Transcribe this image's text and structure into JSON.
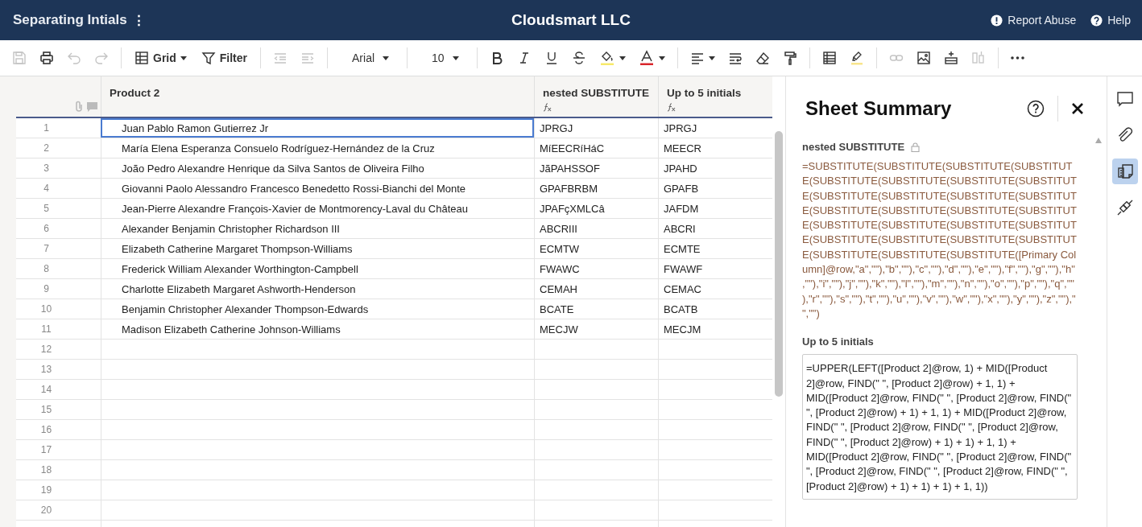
{
  "header": {
    "sheet_title": "Separating Intials",
    "menu_glyph": "⋮",
    "company": "Cloudsmart LLC",
    "links": [
      {
        "kind": "report",
        "label": "Report Abuse"
      },
      {
        "kind": "help",
        "label": "Help"
      }
    ]
  },
  "toolbar": {
    "save": {
      "disabled": true
    },
    "print": {
      "disabled": false
    },
    "undo": {
      "disabled": true
    },
    "redo": {
      "disabled": true
    },
    "view": {
      "label": "Grid"
    },
    "filter": {
      "label": "Filter"
    },
    "outdent": {
      "disabled": true
    },
    "indent": {
      "disabled": true
    },
    "font": {
      "label": "Arial"
    },
    "size": {
      "label": "10"
    },
    "link": {
      "disabled": true
    },
    "column_props": {
      "disabled": true
    }
  },
  "table": {
    "columns": [
      {
        "name": "Product 2",
        "formula": false
      },
      {
        "name": "nested SUBSTITUTE",
        "formula": true
      },
      {
        "name": "Up to 5 initials",
        "formula": true
      }
    ],
    "rows": [
      {
        "number": "1",
        "selected": true,
        "cells": [
          "Juan Pablo Ramon Gutierrez Jr",
          "JPRGJ",
          "JPRGJ"
        ]
      },
      {
        "number": "2",
        "selected": false,
        "cells": [
          "María Elena Esperanza Consuelo Rodríguez-Hernández de la Cruz",
          "MíEECRíHáC",
          "MEECR"
        ]
      },
      {
        "number": "3",
        "selected": false,
        "cells": [
          "João Pedro Alexandre Henrique da Silva Santos de Oliveira Filho",
          "JãPAHSSOF",
          "JPAHD"
        ]
      },
      {
        "number": "4",
        "selected": false,
        "cells": [
          "Giovanni Paolo Alessandro Francesco Benedetto Rossi-Bianchi del Monte",
          "GPAFBRBM",
          "GPAFB"
        ]
      },
      {
        "number": "5",
        "selected": false,
        "cells": [
          "Jean-Pierre Alexandre François-Xavier de Montmorency-Laval du Château",
          "JPAFçXMLCâ",
          "JAFDM"
        ]
      },
      {
        "number": "6",
        "selected": false,
        "cells": [
          "Alexander Benjamin Christopher Richardson III",
          "ABCRIII",
          "ABCRI"
        ]
      },
      {
        "number": "7",
        "selected": false,
        "cells": [
          "Elizabeth Catherine Margaret Thompson-Williams",
          "ECMTW",
          "ECMTE"
        ]
      },
      {
        "number": "8",
        "selected": false,
        "cells": [
          "Frederick William Alexander Worthington-Campbell",
          "FWAWC",
          "FWAWF"
        ]
      },
      {
        "number": "9",
        "selected": false,
        "cells": [
          "Charlotte Elizabeth Margaret Ashworth-Henderson",
          "CEMAH",
          "CEMAC"
        ]
      },
      {
        "number": "10",
        "selected": false,
        "cells": [
          "Benjamin Christopher Alexander Thompson-Edwards",
          "BCATE",
          "BCATB"
        ]
      },
      {
        "number": "11",
        "selected": false,
        "cells": [
          "Madison Elizabeth Catherine Johnson-Williams",
          "MECJW",
          "MECJM"
        ]
      },
      {
        "number": "12",
        "selected": false,
        "cells": []
      },
      {
        "number": "13",
        "selected": false,
        "cells": []
      },
      {
        "number": "14",
        "selected": false,
        "cells": []
      },
      {
        "number": "15",
        "selected": false,
        "cells": []
      },
      {
        "number": "16",
        "selected": false,
        "cells": []
      },
      {
        "number": "17",
        "selected": false,
        "cells": []
      },
      {
        "number": "18",
        "selected": false,
        "cells": []
      },
      {
        "number": "19",
        "selected": false,
        "cells": []
      },
      {
        "number": "20",
        "selected": false,
        "cells": []
      }
    ]
  },
  "summary": {
    "title": "Sheet Summary",
    "fields": [
      {
        "kind": "text",
        "label": "nested SUBSTITUTE",
        "locked": true,
        "value": "=SUBSTITUTE(SUBSTITUTE(SUBSTITUTE(SUBSTITUTE(SUBSTITUTE(SUBSTITUTE(SUBSTITUTE(SUBSTITUTE(SUBSTITUTE(SUBSTITUTE(SUBSTITUTE(SUBSTITUTE(SUBSTITUTE(SUBSTITUTE(SUBSTITUTE(SUBSTITUTE(SUBSTITUTE(SUBSTITUTE(SUBSTITUTE(SUBSTITUTE(SUBSTITUTE(SUBSTITUTE(SUBSTITUTE(SUBSTITUTE(SUBSTITUTE(SUBSTITUTE(SUBSTITUTE([Primary Column]@row,\"a\",\"\"),\"b\",\"\"),\"c\",\"\"),\"d\",\"\"),\"e\",\"\"),\"f\",\"\"),\"g\",\"\"),\"h\",\"\"),\"i\",\"\"),\"j\",\"\"),\"k\",\"\"),\"l\",\"\"),\"m\",\"\"),\"n\",\"\"),\"o\",\"\"),\"p\",\"\"),\"q\",\"\"),\"r\",\"\"),\"s\",\"\"),\"t\",\"\"),\"u\",\"\"),\"v\",\"\"),\"w\",\"\"),\"x\",\"\"),\"y\",\"\"),\"z\",\"\"),\" \",\"\")"
      },
      {
        "kind": "box",
        "label": "Up to 5 initials",
        "locked": false,
        "value": "=UPPER(LEFT([Product 2]@row, 1) + MID([Product 2]@row, FIND(\" \", [Product 2]@row) + 1, 1) + MID([Product 2]@row, FIND(\" \", [Product 2]@row, FIND(\" \", [Product 2]@row) + 1) + 1, 1) + MID([Product 2]@row, FIND(\" \", [Product 2]@row, FIND(\" \", [Product 2]@row, FIND(\" \", [Product 2]@row) + 1) + 1) + 1, 1) + MID([Product 2]@row, FIND(\" \", [Product 2]@row, FIND(\" \", [Product 2]@row, FIND(\" \", [Product 2]@row, FIND(\" \", [Product 2]@row) + 1) + 1) + 1) + 1, 1))"
      }
    ]
  },
  "rail": [
    {
      "kind": "comments",
      "selected": false
    },
    {
      "kind": "attachments",
      "selected": false
    },
    {
      "kind": "summary",
      "selected": true
    },
    {
      "kind": "connections",
      "selected": false
    }
  ]
}
